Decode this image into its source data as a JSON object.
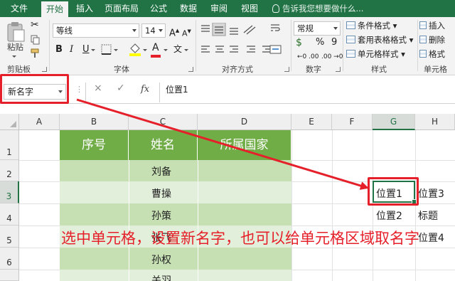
{
  "ribbon_tabs": [
    "文件",
    "开始",
    "插入",
    "页面布局",
    "公式",
    "数据",
    "审阅",
    "视图"
  ],
  "active_tab": "开始",
  "tell_me": "告诉我您想要做什么...",
  "clipboard": {
    "paste_label": "粘贴",
    "group_label": "剪贴板"
  },
  "font": {
    "name": "等线",
    "size": "14",
    "bold": "B",
    "italic": "I",
    "underline": "U",
    "group_label": "字体",
    "color_letter": "A"
  },
  "alignment": {
    "group_label": "对齐方式"
  },
  "number": {
    "format": "常规",
    "percent": "%",
    "comma": "9",
    "group_label": "数字"
  },
  "styles": {
    "conditional": "条件格式",
    "table": "套用表格格式",
    "cell": "单元格样式",
    "group_label": "样式"
  },
  "cells": {
    "insert": "插入",
    "delete": "删除",
    "format": "格式",
    "group_label": "单元格"
  },
  "formula_bar": {
    "name_box": "新名字",
    "fx": "fx",
    "cancel": "×",
    "enter": "✓",
    "content": "位置1"
  },
  "columns": [
    "A",
    "B",
    "C",
    "D",
    "E",
    "F",
    "G",
    "H"
  ],
  "selected_column": "G",
  "rows": [
    "1",
    "2",
    "3",
    "4",
    "5",
    "6"
  ],
  "selected_row": "3",
  "table": {
    "headers": [
      "序号",
      "姓名",
      "所属国家"
    ],
    "names": [
      "刘备",
      "曹操",
      "孙策",
      "张飞",
      "孙权",
      "关羽"
    ]
  },
  "side_cells": {
    "g3": "位置1",
    "h3": "位置3",
    "g4": "位置2",
    "h4": "标题",
    "h5": "位置4"
  },
  "annotation": "选中单元格，设置新名字，也可以给单元格区域取名字",
  "colors": {
    "excel_green": "#217346",
    "header_green": "#70ad47",
    "band_dark": "#c6e0b4",
    "band_light": "#e2efda",
    "annotation_red": "#e5202a"
  }
}
